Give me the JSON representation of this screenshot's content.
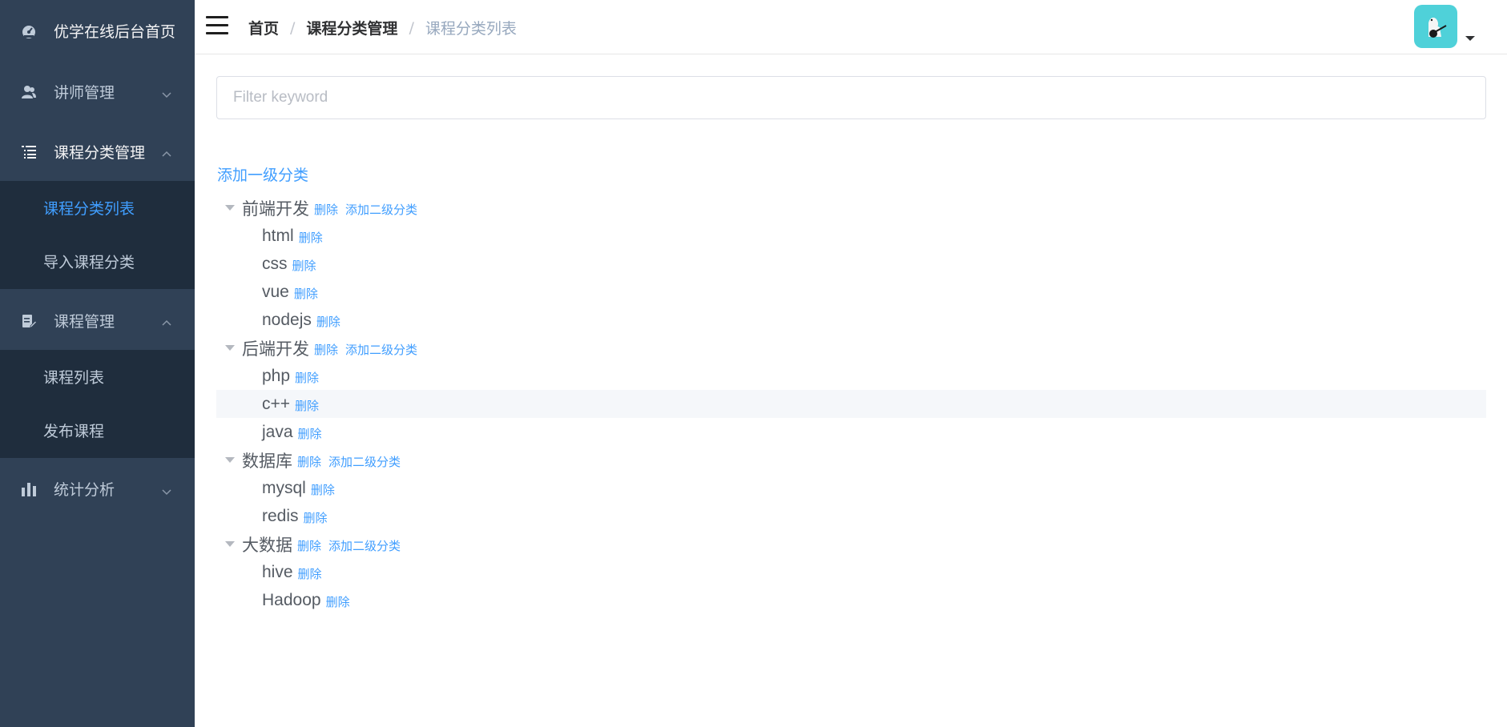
{
  "sidebar": {
    "title": "优学在线后台首页",
    "teacher": "讲师管理",
    "subject": {
      "label": "课程分类管理",
      "children": [
        "课程分类列表",
        "导入课程分类"
      ]
    },
    "course": {
      "label": "课程管理",
      "children": [
        "课程列表",
        "发布课程"
      ]
    },
    "stats": "统计分析"
  },
  "navbar": {
    "breadcrumb": [
      "首页",
      "课程分类管理",
      "课程分类列表"
    ],
    "separator": "/"
  },
  "filter": {
    "placeholder": "Filter keyword"
  },
  "tree": {
    "add_first_label": "添加一级分类",
    "delete_label": "删除",
    "add_second_label": "添加二级分类",
    "groups": [
      {
        "name": "前端开发",
        "children": [
          "html",
          "css",
          "vue",
          "nodejs"
        ]
      },
      {
        "name": "后端开发",
        "children": [
          "php",
          "c++",
          "java"
        ]
      },
      {
        "name": "数据库",
        "children": [
          "mysql",
          "redis"
        ]
      },
      {
        "name": "大数据",
        "children": [
          "hive",
          "Hadoop"
        ]
      }
    ]
  },
  "colors": {
    "sidebar_bg": "#304156",
    "submenu_bg": "#1f2d3d",
    "sidebar_text": "#bfcbd9",
    "accent": "#409eff",
    "avatar_bg": "#4fd1d9"
  }
}
